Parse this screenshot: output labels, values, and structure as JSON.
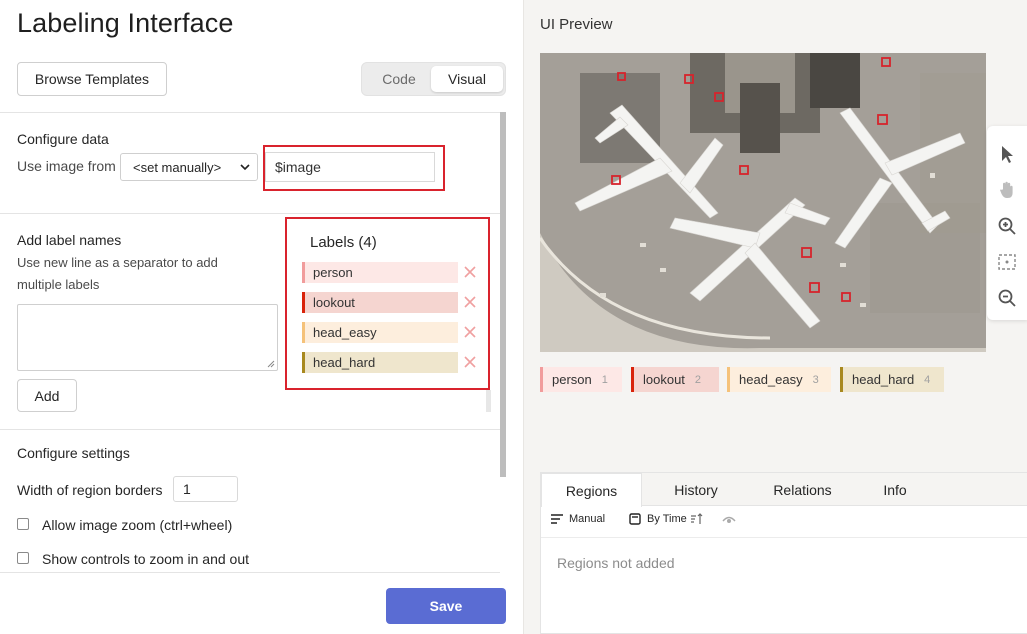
{
  "left": {
    "title": "Labeling Interface",
    "browse_label": "Browse Templates",
    "mode_code": "Code",
    "mode_visual": "Visual",
    "configure_data": {
      "heading": "Configure data",
      "use_image_label": "Use image from",
      "select_value": "<set manually>",
      "image_value": "$image"
    },
    "add_labels": {
      "heading": "Add label names",
      "hint_line1": "Use new line as a separator to add",
      "hint_line2": "multiple labels",
      "add_label": "Add"
    },
    "labels": {
      "title": "Labels (4)",
      "items": [
        {
          "name": "person",
          "color": "#f19c9c",
          "bg": "#fde8e6"
        },
        {
          "name": "lookout",
          "color": "#d9230b",
          "bg": "#f5d5d0"
        },
        {
          "name": "head_easy",
          "color": "#f5c27a",
          "bg": "#fdeedd"
        },
        {
          "name": "head_hard",
          "color": "#a8891f",
          "bg": "#efe6cd"
        }
      ]
    },
    "settings": {
      "heading": "Configure settings",
      "border_label": "Width of region borders",
      "border_value": "1",
      "zoom_label": "Allow image zoom (ctrl+wheel)",
      "controls_label": "Show controls to zoom in and out"
    },
    "save_label": "Save"
  },
  "right": {
    "title": "UI Preview",
    "tags": [
      {
        "name": "person",
        "hotkey": "1",
        "color": "#f19c9c",
        "bg": "#fde8e6"
      },
      {
        "name": "lookout",
        "hotkey": "2",
        "color": "#d9230b",
        "bg": "#f5d5d0"
      },
      {
        "name": "head_easy",
        "hotkey": "3",
        "color": "#f5c27a",
        "bg": "#fdeedd"
      },
      {
        "name": "head_hard",
        "hotkey": "4",
        "color": "#a8891f",
        "bg": "#efe6cd"
      }
    ],
    "tabs": [
      "Regions",
      "History",
      "Relations",
      "Info"
    ],
    "controls": {
      "manual": "Manual",
      "by_time": "By Time"
    },
    "empty_text": "Regions not added"
  },
  "icons": [
    "chevron-down-icon",
    "close-icon",
    "cursor-icon",
    "hand-icon",
    "zoom-in-icon",
    "fit-screen-icon",
    "zoom-out-icon",
    "list-icon",
    "clock-icon",
    "sort-icon",
    "eye-icon"
  ],
  "colors": {
    "accent": "#5a6cd3",
    "highlight_box": "#d9232d"
  }
}
